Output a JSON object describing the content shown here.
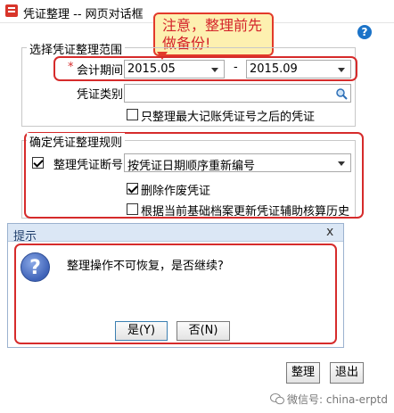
{
  "window": {
    "title": "凭证整理 -- 网页对话框"
  },
  "callout": {
    "line1": "注意，整理前先",
    "line2": "做备份!"
  },
  "help": {
    "icon": "question-icon",
    "symbol": "?"
  },
  "range_group": {
    "legend": "选择凭证整理范围",
    "period_label": "会计期间",
    "required_mark": "*",
    "period_start": "2015.05",
    "period_separator": "-",
    "period_end": "2015.09",
    "voucher_type_label": "凭证类别",
    "voucher_type_value": "",
    "only_after_max_label": "只整理最大记账凭证号之后的凭证"
  },
  "rules_group": {
    "legend": "确定凭证整理规则",
    "renumber_label": "整理凭证断号",
    "renumber_checked": true,
    "renumber_method": "按凭证日期顺序重新编号",
    "delete_void_label": "删除作废凭证",
    "delete_void_checked": true,
    "update_history_label": "根据当前基础档案更新凭证辅助核算历史",
    "update_history_checked": false
  },
  "prompt_dialog": {
    "title": "提示",
    "close_symbol": "x",
    "message": "整理操作不可恢复，是否继续?",
    "yes_label": "是(Y)",
    "no_label": "否(N)"
  },
  "footer": {
    "ok_label": "整理",
    "exit_label": "退出"
  },
  "watermark": {
    "text": "微信号: china-erptd"
  },
  "colors": {
    "accent": "#d62b2b",
    "callout_bg": "#fdf0b0",
    "dialog_title_bg": "#dbe7f5"
  }
}
